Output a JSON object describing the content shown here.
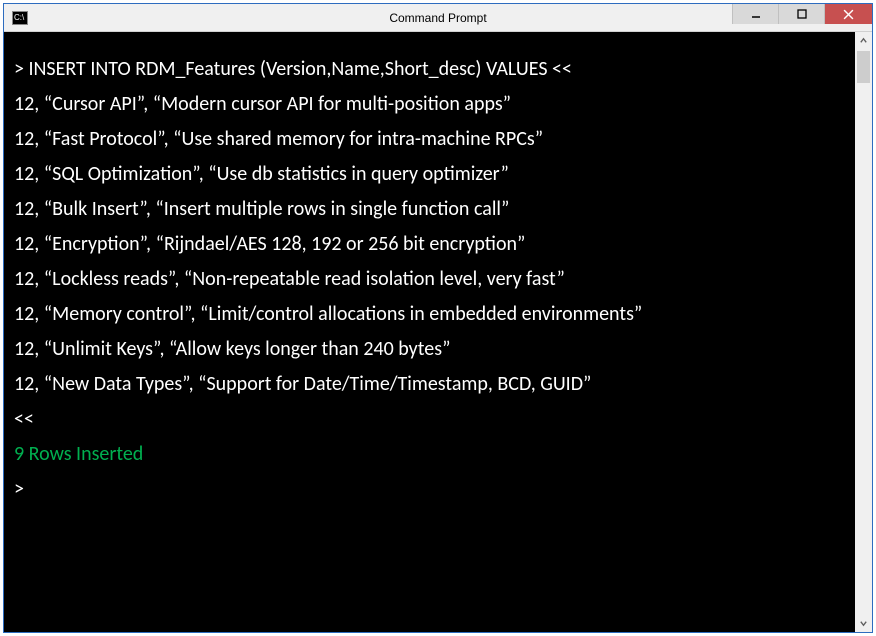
{
  "window": {
    "title": "Command Prompt",
    "icon_label": "C:\\"
  },
  "console": {
    "command": "> INSERT INTO RDM_Features (Version,Name,Short_desc) VALUES <<",
    "rows": [
      "12, “Cursor API”, “Modern cursor API for multi-position apps”",
      "12, “Fast Protocol”, “Use shared memory for intra-machine RPCs”",
      "12, “SQL Optimization”, “Use db statistics in query optimizer”",
      "12, “Bulk Insert”, “Insert multiple rows in single function call”",
      "12, “Encryption”, “Rijndael/AES 128, 192 or 256 bit encryption”",
      "12, “Lockless reads”, “Non-repeatable read isolation level, very fast”",
      "12, “Memory control”, “Limit/control allocations in embedded environments”",
      "12, “Unlimit Keys”, “Allow keys longer than 240 bytes”",
      "12, “New Data Types”, “Support for Date/Time/Timestamp, BCD, GUID”"
    ],
    "terminator": "<<",
    "status": "9 Rows Inserted",
    "prompt": ">"
  }
}
